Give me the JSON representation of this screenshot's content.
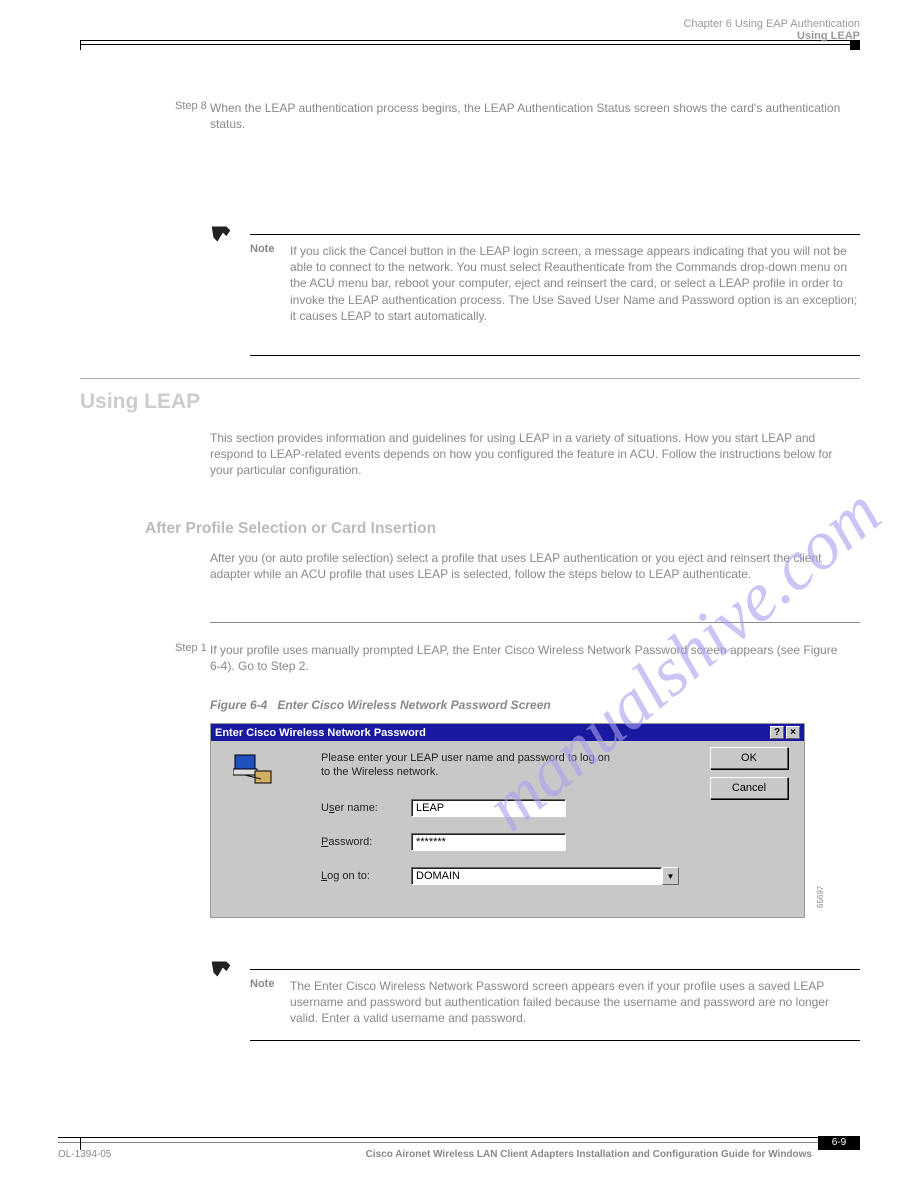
{
  "header": {
    "chapter": "Chapter 6      Using EAP Authentication",
    "section": "Using LEAP"
  },
  "step8": {
    "num": "Step 8",
    "text": "When the LEAP authentication process begins, the LEAP Authentication Status screen shows the card's authentication status."
  },
  "note1": {
    "label": "Note",
    "text": "If you click the Cancel button in the LEAP login screen, a message appears indicating that you will not be able to connect to the network. You must select Reauthenticate from the Commands drop-down menu on the ACU menu bar, reboot your computer, eject and reinsert the card, or select a LEAP profile in order to invoke the LEAP authentication process. The Use Saved User Name and Password option is an exception; it causes LEAP to start automatically."
  },
  "h2": {
    "rule_above": true,
    "title": "Using LEAP",
    "intro": "This section provides information and guidelines for using LEAP in a variety of situations. How you start LEAP and respond to LEAP-related events depends on how you configured the feature in ACU. Follow the instructions below for your particular configuration."
  },
  "h3": "After Profile Selection or Card Insertion",
  "after_profile_text": "After you (or auto profile selection) select a profile that uses LEAP authentication or you eject and reinsert the client adapter while an ACU profile that uses LEAP is selected, follow the steps below to LEAP authenticate.",
  "step1": {
    "num": "Step 1",
    "text": "If your profile uses manually prompted LEAP, the Enter Cisco Wireless Network Password screen appears (see Figure 6-4). Go to Step 2."
  },
  "figure": {
    "caption_label": "Figure 6-4",
    "caption_text": "Enter Cisco Wireless Network Password Screen",
    "id": "65697"
  },
  "dialog": {
    "title": "Enter Cisco Wireless Network Password",
    "prompt": "Please enter your LEAP user name and password to log on to the Wireless network.",
    "username_label_pre": "U",
    "username_label_u": "s",
    "username_label_post": "er name:",
    "username_value": "LEAP",
    "password_label_u": "P",
    "password_label_post": "assword:",
    "password_value": "*******",
    "logon_label_pre": "",
    "logon_label_u": "L",
    "logon_label_post": "og on to:",
    "logon_value": "DOMAIN",
    "ok": "OK",
    "cancel": "Cancel"
  },
  "note2": {
    "label": "Note",
    "text": "The Enter Cisco Wireless Network Password screen appears even if your profile uses a saved LEAP username and password but authentication failed because the username and password are no longer valid. Enter a valid username and password."
  },
  "footer": {
    "left": "OL-1394-05",
    "right": "Cisco Aironet Wireless LAN Client Adapters Installation and Configuration Guide for Windows",
    "page": "6-9"
  },
  "watermark": "manualshive.com"
}
